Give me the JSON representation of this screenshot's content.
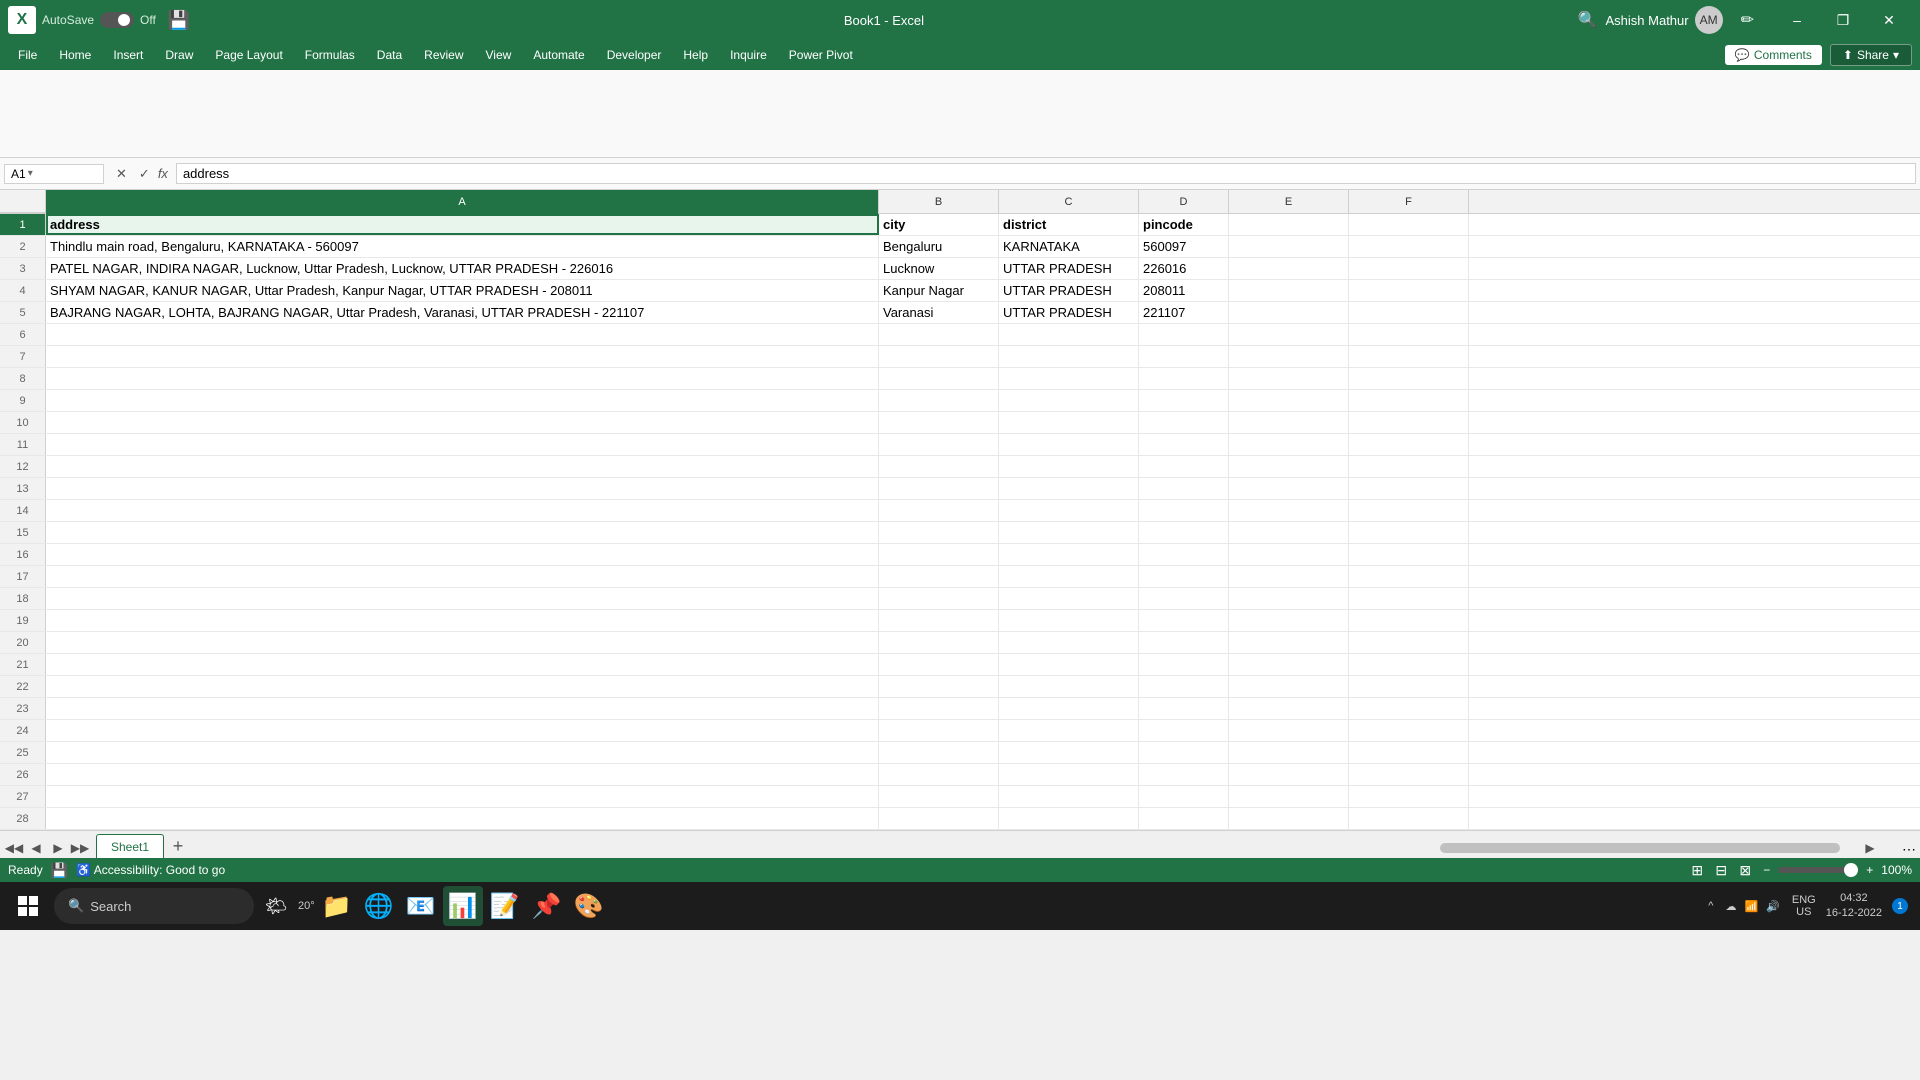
{
  "titleBar": {
    "logoText": "X",
    "autoSaveLabel": "AutoSave",
    "toggleState": "Off",
    "saveIcon": "💾",
    "bookName": "Book1  -  Excel",
    "searchTitle": "Search",
    "userName": "Ashish Mathur",
    "minimizeLabel": "–",
    "maximizeLabel": "❐",
    "closeLabel": "✕",
    "penIcon": "✏"
  },
  "menuBar": {
    "items": [
      "File",
      "Home",
      "Insert",
      "Draw",
      "Page Layout",
      "Formulas",
      "Data",
      "Review",
      "View",
      "Automate",
      "Developer",
      "Help",
      "Inquire",
      "Power Pivot"
    ],
    "commentsLabel": "Comments",
    "shareLabel": "Share"
  },
  "formulaBar": {
    "nameBox": "A1",
    "cancelBtn": "✕",
    "confirmBtn": "✓",
    "fxLabel": "fx",
    "formula": "address"
  },
  "columns": {
    "headers": [
      "A",
      "B",
      "C",
      "D",
      "E",
      "F"
    ]
  },
  "rows": [
    {
      "num": 1,
      "cells": [
        "address",
        "city",
        "district",
        "pincode",
        "",
        ""
      ]
    },
    {
      "num": 2,
      "cells": [
        "Thindlu main road, Bengaluru, KARNATAKA - 560097",
        "Bengaluru",
        "KARNATAKA",
        "560097",
        "",
        ""
      ]
    },
    {
      "num": 3,
      "cells": [
        "PATEL NAGAR, INDIRA NAGAR, Lucknow, Uttar Pradesh, Lucknow, UTTAR PRADESH - 226016",
        "Lucknow",
        "UTTAR PRADESH",
        "226016",
        "",
        ""
      ]
    },
    {
      "num": 4,
      "cells": [
        "SHYAM NAGAR, KANUR NAGAR, Uttar Pradesh, Kanpur Nagar, UTTAR PRADESH - 208011",
        "Kanpur Nagar",
        "UTTAR PRADESH",
        "208011",
        "",
        ""
      ]
    },
    {
      "num": 5,
      "cells": [
        "BAJRANG NAGAR, LOHTA, BAJRANG NAGAR, Uttar Pradesh, Varanasi, UTTAR PRADESH - 221107",
        "Varanasi",
        "UTTAR PRADESH",
        "221107",
        "",
        ""
      ]
    }
  ],
  "emptyRows": [
    6,
    7,
    8,
    9,
    10,
    11,
    12,
    13,
    14,
    15,
    16,
    17,
    18,
    19,
    20,
    21,
    22,
    23,
    24,
    25,
    26,
    27,
    28
  ],
  "sheetTabs": {
    "tabs": [
      "Sheet1"
    ],
    "activeTab": "Sheet1"
  },
  "statusBar": {
    "ready": "Ready",
    "accessibility": "Accessibility: Good to go",
    "zoomLevel": "100%"
  },
  "taskbar": {
    "searchPlaceholder": "Search",
    "weather": "20°",
    "language": "ENG\nUS",
    "time": "04:32",
    "date": "16-12-2022",
    "notificationCount": "1"
  }
}
